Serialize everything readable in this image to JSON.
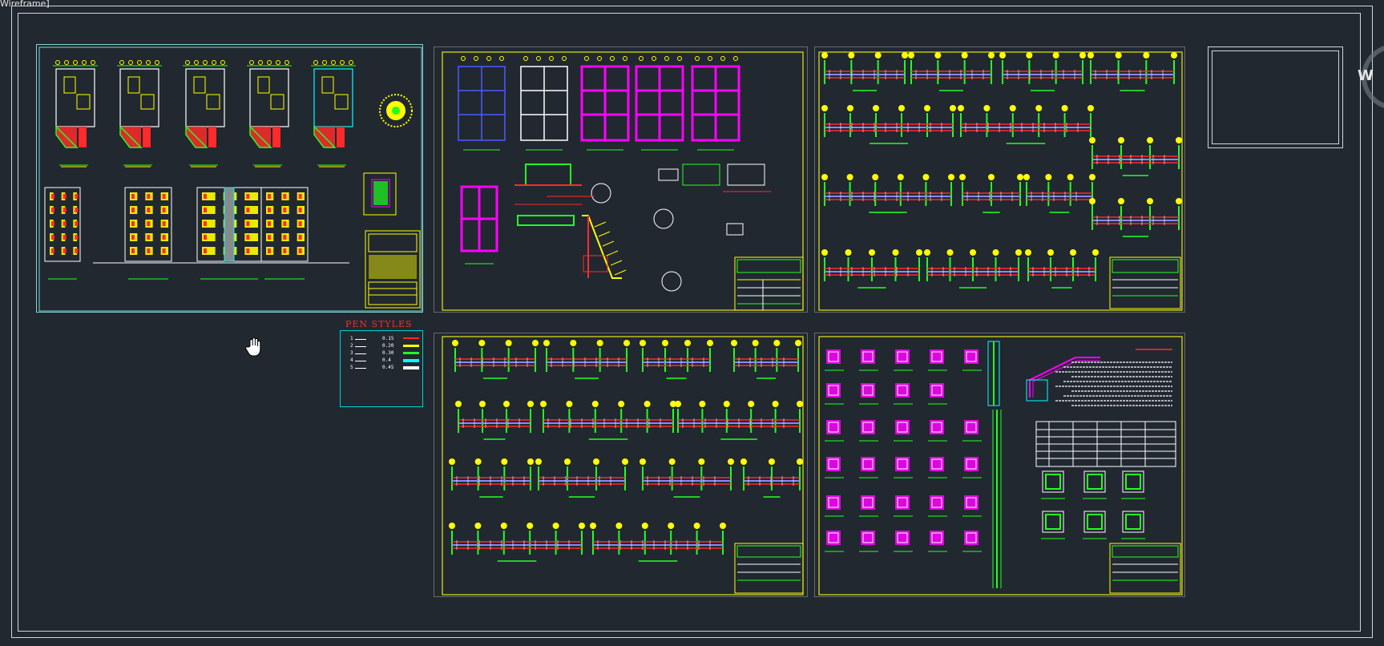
{
  "viewport": {
    "label": "Wireframe]"
  },
  "pen_styles": {
    "title": "PEN STYLES",
    "rows": [
      {
        "index": "1",
        "weight": "0.15",
        "color": "#ff2a2a"
      },
      {
        "index": "2",
        "weight": "0.20",
        "color": "#ffff00"
      },
      {
        "index": "3",
        "weight": "0.30",
        "color": "#22ff22"
      },
      {
        "index": "4",
        "weight": "0.4",
        "color": "#00ffff"
      },
      {
        "index": "5",
        "weight": "0.45",
        "color": "#ffffff"
      }
    ]
  },
  "viewcube": {
    "letter": "W"
  },
  "cursor": {
    "icon": "hand-pan-icon"
  },
  "colors": {
    "background": "#212830",
    "sheet_border_yellow": "#e5e51a",
    "sheet_border_cyan": "#7fd4d4",
    "outline": "#cfd6dc"
  }
}
